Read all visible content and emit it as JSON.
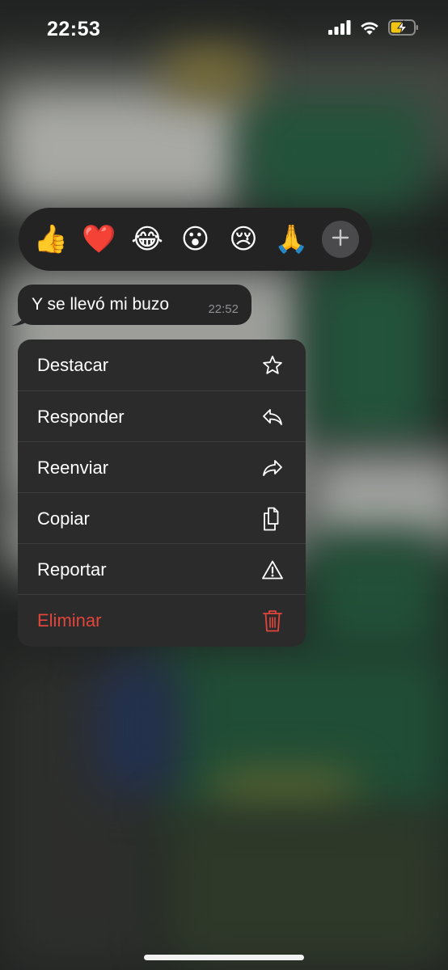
{
  "status_bar": {
    "time": "22:53",
    "icons": [
      "cellular-signal-icon",
      "wifi-icon",
      "battery-charging-icon"
    ]
  },
  "reactions": {
    "emojis": [
      "👍",
      "❤️",
      "😂",
      "😮",
      "😢",
      "🙏"
    ],
    "more_icon": "plus-icon"
  },
  "message": {
    "text": "Y se llevó mi buzo",
    "time": "22:52"
  },
  "context_menu": {
    "items": [
      {
        "label": "Destacar",
        "icon": "star-icon"
      },
      {
        "label": "Responder",
        "icon": "reply-icon"
      },
      {
        "label": "Reenviar",
        "icon": "forward-icon"
      },
      {
        "label": "Copiar",
        "icon": "copy-icon"
      },
      {
        "label": "Reportar",
        "icon": "warning-icon"
      },
      {
        "label": "Eliminar",
        "icon": "trash-icon",
        "destructive": true
      }
    ]
  },
  "colors": {
    "menu_background": "#2b2b2b",
    "destructive": "#e2453c",
    "reaction_bar": "#232323"
  }
}
